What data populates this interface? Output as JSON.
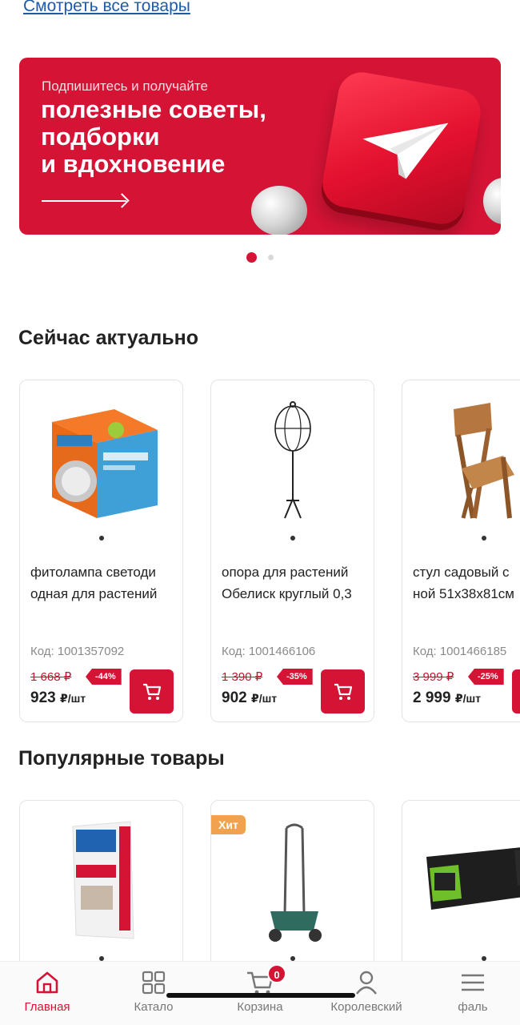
{
  "see_all_link": "Смотреть все товары",
  "banner": {
    "kicker": "Подпишитесь и получайте",
    "headline": "полезные советы,\nподборки\nи вдохновение",
    "icon": "telegram-paper-plane-icon",
    "slides_total": 2,
    "active_slide": 1
  },
  "sections": [
    {
      "title": "Сейчас актуально",
      "products": [
        {
          "name": "фитолампа светоди\nодная для растений",
          "code": "Код: 1001357092",
          "old_price": "1 668 ₽",
          "discount": "-44%",
          "price": "923",
          "unit": "₽/шт",
          "image": "grow-lamp-box"
        },
        {
          "name": "опора для растений\nОбелиск круглый 0,3",
          "code": "Код: 1001466106",
          "old_price": "1 390 ₽",
          "discount": "-35%",
          "price": "902",
          "unit": "₽/шт",
          "image": "plant-support-obelisk"
        },
        {
          "name": "стул садовый с\nной 51х38х81см",
          "code": "Код: 1001466185",
          "old_price": "3 999 ₽",
          "discount": "-25%",
          "price": "2 999",
          "unit": "₽/шт",
          "image": "wooden-garden-chair"
        }
      ]
    },
    {
      "title": "Популярные товары",
      "products": [
        {
          "image": "knauf-rotband-bag",
          "badge": ""
        },
        {
          "image": "garden-spreader",
          "badge": "Хит"
        },
        {
          "image": "battery-pack",
          "badge": ""
        }
      ]
    }
  ],
  "bottom_nav": [
    {
      "label": "Главная",
      "icon": "home-icon",
      "active": true
    },
    {
      "label": "Катало",
      "icon": "catalog-grid-icon",
      "active": false
    },
    {
      "label": "Корзина",
      "icon": "cart-icon",
      "badge": "0",
      "active": false
    },
    {
      "label": "Королевский",
      "icon": "profile-icon",
      "active": false
    },
    {
      "label": "фаль",
      "icon": "menu-icon",
      "active": false
    }
  ],
  "colors": {
    "brand_red": "#d41335",
    "link_blue": "#1e5aa8",
    "hit_badge": "#f0a24e"
  }
}
